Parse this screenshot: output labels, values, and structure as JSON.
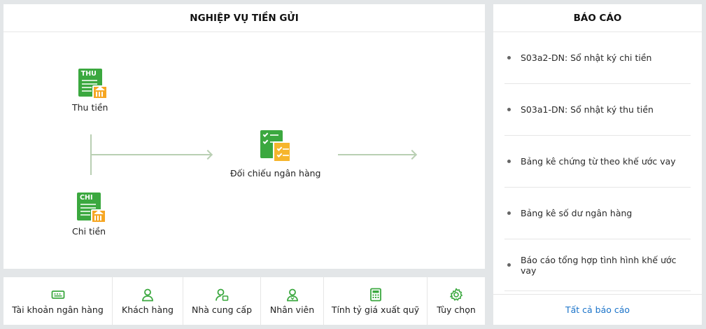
{
  "main": {
    "title": "NGHIỆP VỤ TIỀN GỬI",
    "nodes": {
      "receipt": {
        "label": "Thu tiền",
        "tag": "THU"
      },
      "payment": {
        "label": "Chi tiền",
        "tag": "CHI"
      },
      "reconcile": {
        "label": "Đối chiếu ngân hàng"
      }
    }
  },
  "report": {
    "title": "BÁO CÁO",
    "items": [
      {
        "label": "S03a2-DN: Sổ nhật ký chi tiền"
      },
      {
        "label": "S03a1-DN: Sổ nhật ký thu tiền"
      },
      {
        "label": "Bảng kê chứng từ theo khế ước vay"
      },
      {
        "label": "Bảng kê số dư ngân hàng"
      },
      {
        "label": "Báo cáo tổng hợp tình hình khế ước vay"
      }
    ],
    "all_link": "Tất cả báo cáo"
  },
  "toolbar": {
    "items": [
      {
        "label": "Tài khoản ngân hàng",
        "icon": "bank-card-icon"
      },
      {
        "label": "Khách hàng",
        "icon": "customer-icon"
      },
      {
        "label": "Nhà cung cấp",
        "icon": "supplier-icon"
      },
      {
        "label": "Nhân viên",
        "icon": "employee-icon"
      },
      {
        "label": "Tính tỷ giá xuất quỹ",
        "icon": "calculator-icon"
      },
      {
        "label": "Tùy chọn",
        "icon": "gear-icon"
      }
    ]
  },
  "colors": {
    "accent_green": "#3ba83f",
    "accent_orange": "#f6a623",
    "link_blue": "#1a73c9",
    "connector": "#b9cfb3"
  }
}
